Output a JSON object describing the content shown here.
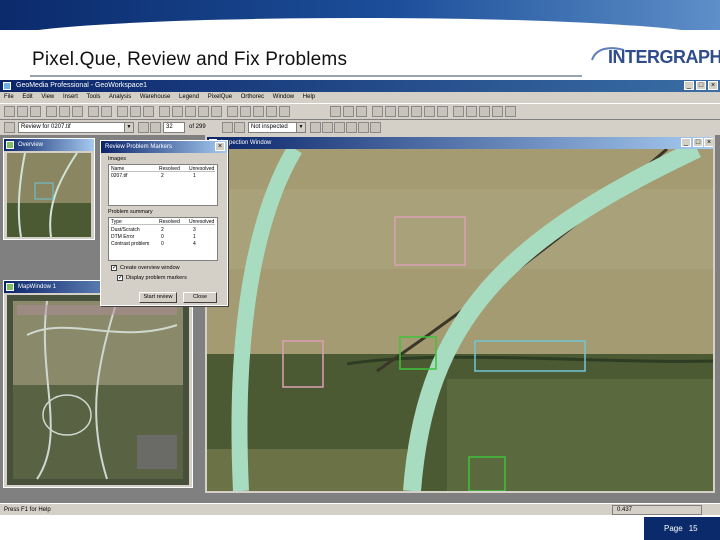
{
  "slide": {
    "title": "Pixel.Que, Review and Fix Problems",
    "logo": "INTERGRAPH",
    "page_label": "Page",
    "page_number": "15"
  },
  "app": {
    "title": "GeoMedia Professional - GeoWorkspace1",
    "menu": [
      "File",
      "Edit",
      "View",
      "Insert",
      "Tools",
      "Analysis",
      "Warehouse",
      "Legend",
      "PixelQue",
      "Orthorec",
      "Window",
      "Help"
    ],
    "toolbar": {
      "review_combo": "Review for 0207.tif",
      "page_field": "32",
      "page_total": "of 299",
      "status_combo": "Not inspected"
    },
    "statusbar": {
      "prompt": "Press F1 for Help",
      "coords": "0.437"
    }
  },
  "windows": {
    "overview_title": "Overview",
    "map_window_title": "MapWindow 1",
    "inspection_title": "Inspection Window"
  },
  "dialog": {
    "title": "Review Problem Markers",
    "images_label": "Images",
    "images_headers": [
      "Name",
      "Resolved",
      "Unresolved"
    ],
    "images_rows": [
      {
        "name": "0207.tif",
        "resolved": "2",
        "unresolved": "1"
      }
    ],
    "summary_label": "Problem summary",
    "summary_headers": [
      "Type",
      "Resolved",
      "Unresolved"
    ],
    "summary_rows": [
      {
        "type": "Dust/Scratch",
        "resolved": "2",
        "unresolved": "3"
      },
      {
        "type": "DTM Error",
        "resolved": "0",
        "unresolved": "1"
      },
      {
        "type": "Contrast problem",
        "resolved": "0",
        "unresolved": "4"
      }
    ],
    "create_overview_label": "Create overview window",
    "display_marker_label": "Display problem markers",
    "start_review_label": "Start review",
    "close_label": "Close"
  },
  "colors": {
    "title_band": "#0b2a6b",
    "road": "#a8dcc0",
    "marker_pink": "#d9a0b4",
    "marker_green": "#3ec23a",
    "marker_cyan": "#6ec7d4"
  },
  "icons": [
    "app-icon",
    "minimize-icon",
    "maximize-icon",
    "close-icon",
    "toolbar-icon",
    "dropdown-arrow-icon"
  ]
}
